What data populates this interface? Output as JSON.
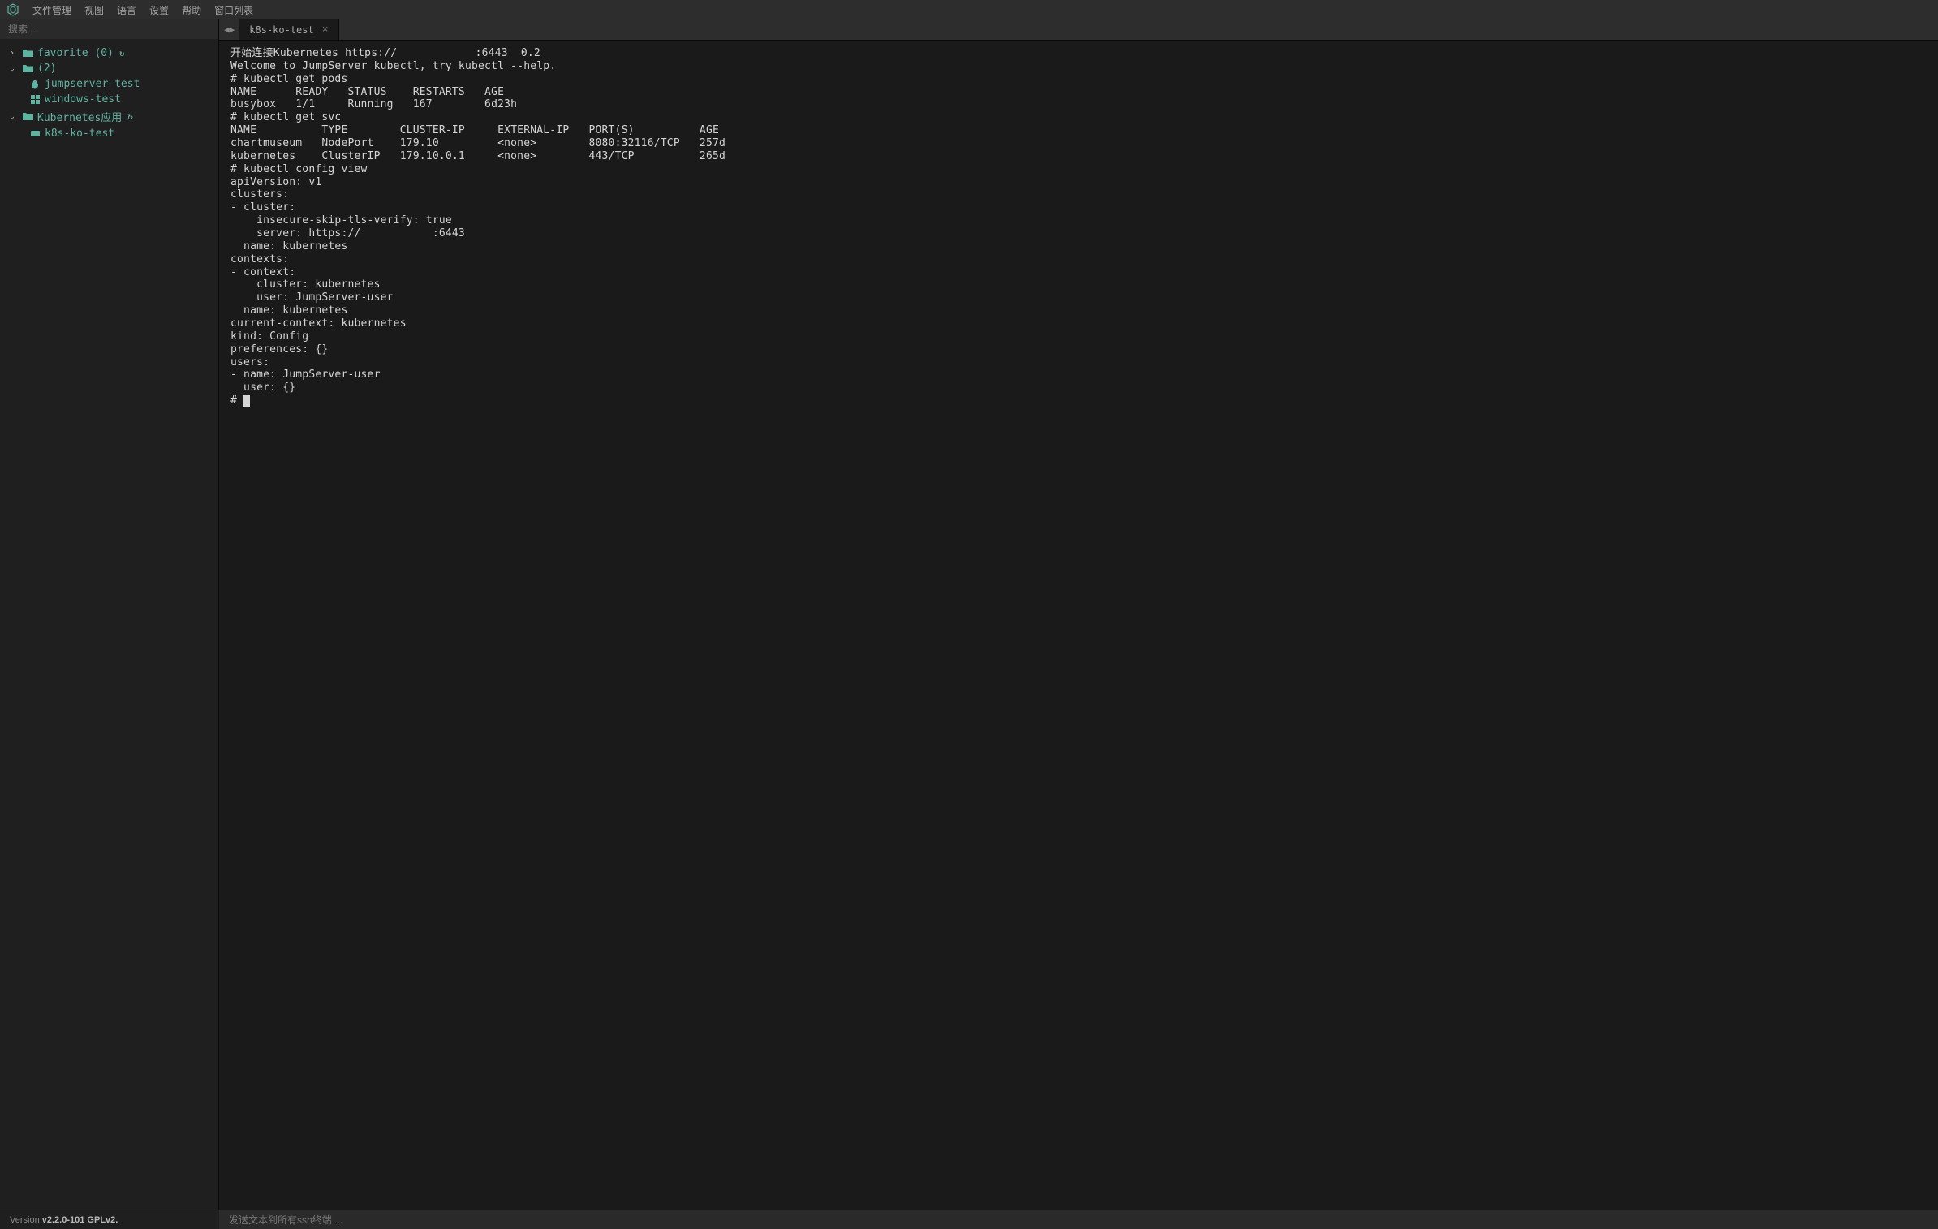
{
  "menubar": {
    "items": [
      "文件管理",
      "视图",
      "语言",
      "设置",
      "帮助",
      "窗口列表"
    ]
  },
  "sidebar": {
    "search_placeholder": "搜索 ...",
    "tree": [
      {
        "type": "group",
        "expanded": false,
        "icon": "folder",
        "label": "favorite (0)",
        "refresh": true
      },
      {
        "type": "group",
        "expanded": true,
        "icon": "folder",
        "label": "       (2)",
        "refresh": false,
        "children": [
          {
            "icon": "linux",
            "label": "jumpserver-test"
          },
          {
            "icon": "windows",
            "label": "windows-test"
          }
        ]
      },
      {
        "type": "group",
        "expanded": true,
        "icon": "folder",
        "label": "Kubernetes应用",
        "refresh": true,
        "children": [
          {
            "icon": "k8s",
            "label": "k8s-ko-test"
          }
        ]
      }
    ]
  },
  "tabs": {
    "active": "k8s-ko-test",
    "items": [
      {
        "label": "k8s-ko-test"
      }
    ]
  },
  "terminal": {
    "lines": [
      "开始连接Kubernetes https://            :6443  0.2",
      "Welcome to JumpServer kubectl, try kubectl --help.",
      "# kubectl get pods",
      "NAME      READY   STATUS    RESTARTS   AGE",
      "busybox   1/1     Running   167        6d23h",
      "# kubectl get svc",
      "NAME          TYPE        CLUSTER-IP     EXTERNAL-IP   PORT(S)          AGE",
      "chartmuseum   NodePort    179.10         <none>        8080:32116/TCP   257d",
      "kubernetes    ClusterIP   179.10.0.1     <none>        443/TCP          265d",
      "# kubectl config view",
      "apiVersion: v1",
      "clusters:",
      "- cluster:",
      "    insecure-skip-tls-verify: true",
      "    server: https://           :6443",
      "  name: kubernetes",
      "contexts:",
      "- context:",
      "    cluster: kubernetes",
      "    user: JumpServer-user",
      "  name: kubernetes",
      "current-context: kubernetes",
      "kind: Config",
      "preferences: {}",
      "users:",
      "- name: JumpServer-user",
      "  user: {}",
      "# "
    ]
  },
  "footer": {
    "version_prefix": "Version ",
    "version": "v2.2.0-101 GPLv2.",
    "broadcast_placeholder": "发送文本到所有ssh终端 ..."
  },
  "colors": {
    "accent": "#5fb3a1",
    "bg_dark": "#1a1a1a",
    "bg_panel": "#1f1f1f",
    "bg_bar": "#2d2d2d"
  }
}
